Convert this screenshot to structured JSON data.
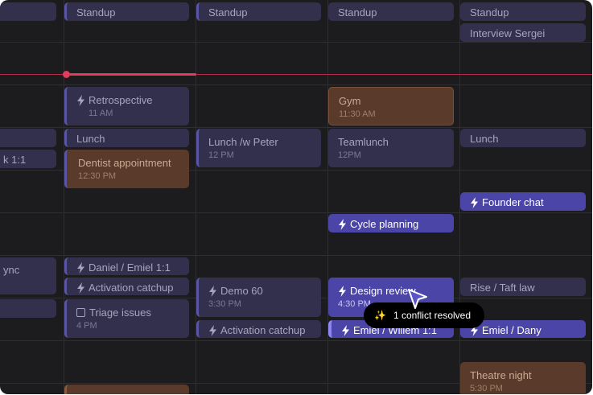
{
  "events": [
    {
      "id": "col0-top",
      "title": "",
      "sub": ""
    },
    {
      "id": "col0-lunch",
      "title": "",
      "sub": ""
    },
    {
      "id": "col0-1on1",
      "title": "k 1:1",
      "sub": ""
    },
    {
      "id": "col0-sync",
      "title": "ync",
      "sub": ""
    },
    {
      "id": "col0-next",
      "title": "",
      "sub": ""
    },
    {
      "id": "mon-standup",
      "title": "Standup",
      "sub": ""
    },
    {
      "id": "mon-retro",
      "title": "Retrospective",
      "sub": "11 AM"
    },
    {
      "id": "mon-lunch",
      "title": "Lunch",
      "sub": ""
    },
    {
      "id": "mon-dentist",
      "title": "Dentist appointment",
      "sub": "12:30 PM"
    },
    {
      "id": "mon-daniel",
      "title": "Daniel / Emiel 1:1",
      "sub": ""
    },
    {
      "id": "mon-activation",
      "title": "Activation catchup",
      "sub": ""
    },
    {
      "id": "mon-triage",
      "title": "Triage issues",
      "sub": "4 PM"
    },
    {
      "id": "tue-standup",
      "title": "Standup",
      "sub": ""
    },
    {
      "id": "tue-lunch",
      "title": "Lunch /w Peter",
      "sub": "12 PM"
    },
    {
      "id": "tue-demo",
      "title": "Demo 60",
      "sub": "3:30 PM"
    },
    {
      "id": "tue-activation",
      "title": "Activation catchup",
      "sub": ""
    },
    {
      "id": "wed-standup",
      "title": "Standup",
      "sub": ""
    },
    {
      "id": "wed-gym",
      "title": "Gym",
      "sub": "11:30 AM"
    },
    {
      "id": "wed-teamlunch",
      "title": "Teamlunch",
      "sub": "12PM"
    },
    {
      "id": "wed-cycle",
      "title": "Cycle planning",
      "sub": ""
    },
    {
      "id": "wed-design",
      "title": "Design review",
      "sub": "4:30 PM"
    },
    {
      "id": "wed-emiel",
      "title": "Emiel / Willem 1:1",
      "sub": ""
    },
    {
      "id": "thu-standup",
      "title": "Standup",
      "sub": ""
    },
    {
      "id": "thu-interview",
      "title": "Interview Sergei",
      "sub": ""
    },
    {
      "id": "thu-lunch",
      "title": "Lunch",
      "sub": ""
    },
    {
      "id": "thu-founder",
      "title": "Founder chat",
      "sub": ""
    },
    {
      "id": "thu-rise",
      "title": "Rise / Taft law",
      "sub": ""
    },
    {
      "id": "thu-emiel",
      "title": "Emiel / Dany",
      "sub": ""
    },
    {
      "id": "thu-theatre",
      "title": "Theatre night",
      "sub": "5:30 PM"
    }
  ],
  "toast": {
    "icon": "sparkles-icon",
    "text": "1 conflict resolved"
  },
  "cursor": {
    "icon": "pointer-cursor-icon",
    "color": "#5b54c9"
  },
  "colors": {
    "background": "#1c1c1e",
    "event_default": "#33304e",
    "event_active": "#4c45a8",
    "event_personal": "#5a3a2a",
    "now_line": "#e43a5c"
  }
}
